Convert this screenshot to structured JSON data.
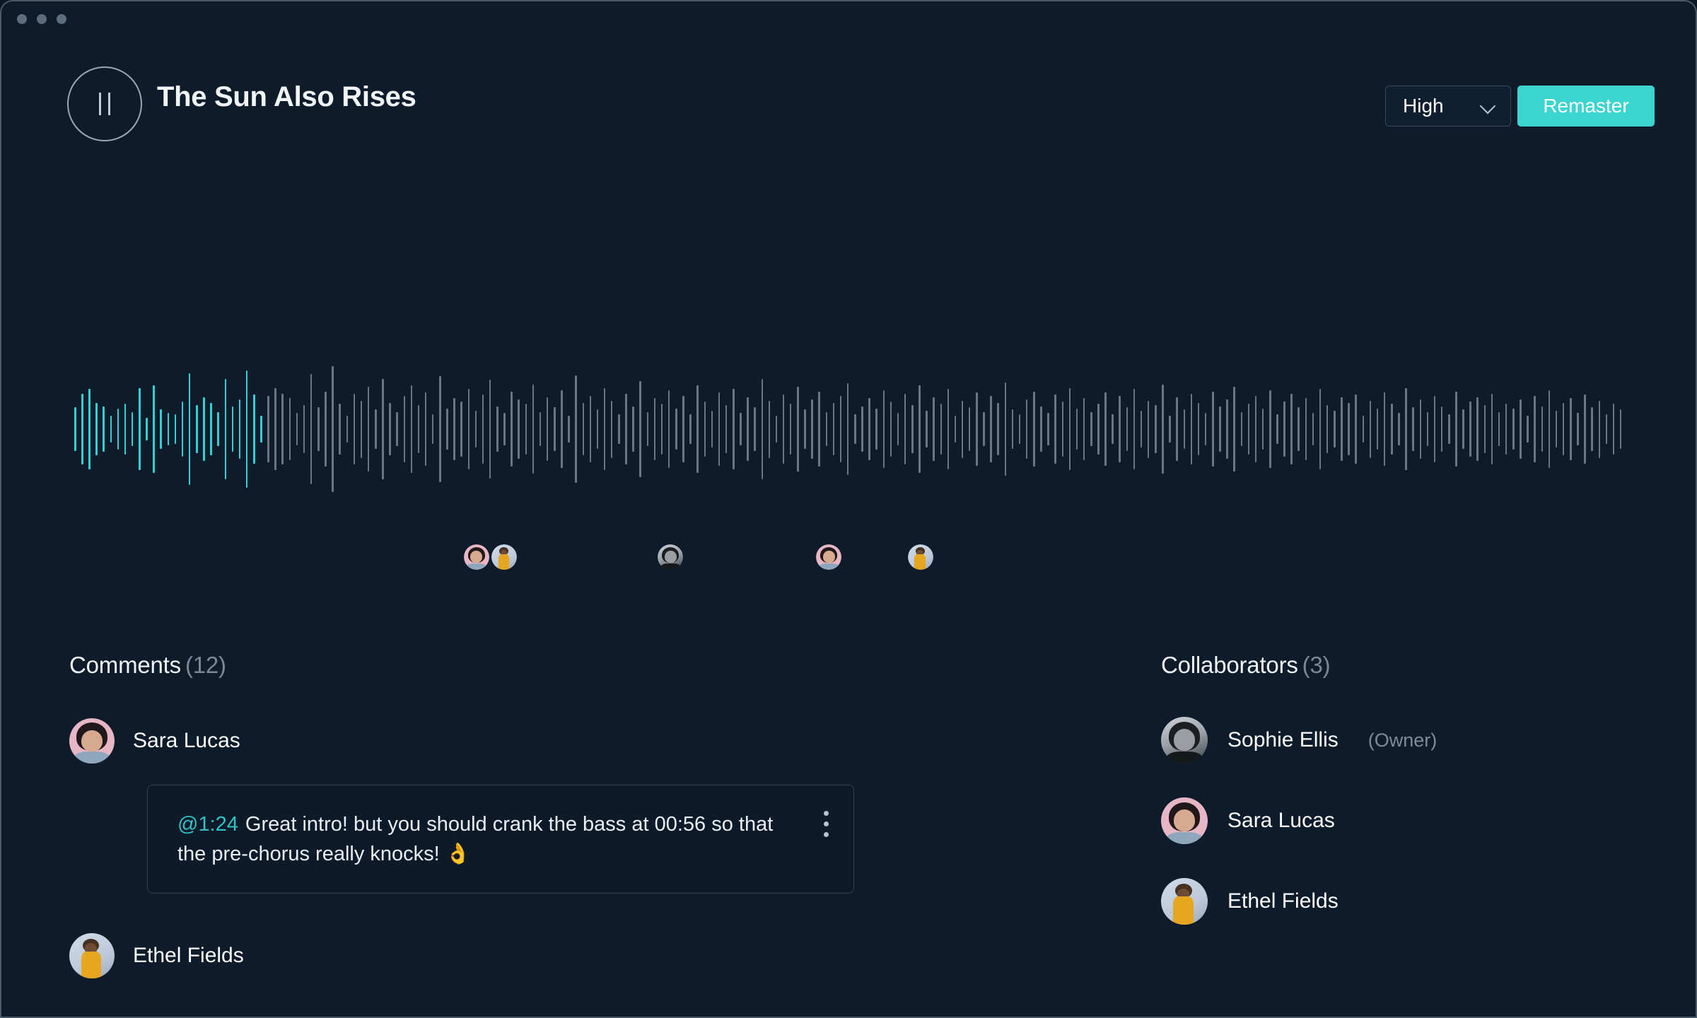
{
  "window": {
    "traffic_lights": [
      "close",
      "minimize",
      "maximize"
    ]
  },
  "header": {
    "play_icon": "pause-icon",
    "track_title": "The Sun Also Rises",
    "quality_value": "High",
    "quality_options": [
      "High"
    ],
    "chevron_icon": "chevron-down-icon",
    "remaster_label": "Remaster"
  },
  "colors": {
    "background": "#0d1b2a",
    "accent_teal": "#3ad5ce",
    "waveform_played": "#2ed3d3",
    "waveform_unplayed": "#8d9aa7",
    "timestamp_teal": "#2fc4c4",
    "muted_text": "#7b8794"
  },
  "waveform": {
    "played_fraction": 0.124,
    "bar_count": 220,
    "heights": [
      38,
      62,
      70,
      46,
      40,
      24,
      36,
      44,
      30,
      72,
      20,
      76,
      34,
      28,
      26,
      48,
      98,
      42,
      56,
      46,
      30,
      88,
      40,
      52,
      102,
      60,
      24,
      58,
      72,
      62,
      54,
      28,
      42,
      96,
      38,
      66,
      110,
      44,
      24,
      62,
      50,
      74,
      34,
      88,
      46,
      30,
      58,
      76,
      42,
      64,
      26,
      92,
      36,
      54,
      48,
      70,
      32,
      60,
      86,
      40,
      28,
      66,
      52,
      44,
      78,
      30,
      56,
      38,
      68,
      24,
      94,
      46,
      58,
      34,
      72,
      50,
      26,
      62,
      40,
      84,
      30,
      54,
      44,
      68,
      36,
      58,
      26,
      76,
      48,
      32,
      64,
      42,
      70,
      28,
      56,
      38,
      88,
      50,
      24,
      60,
      44,
      74,
      34,
      52,
      66,
      30,
      46,
      58,
      80,
      26,
      40,
      54,
      36,
      68,
      48,
      28,
      62,
      42,
      76,
      32,
      56,
      44,
      70,
      24,
      50,
      38,
      64,
      30,
      58,
      46,
      82,
      34,
      26,
      52,
      66,
      40,
      28,
      60,
      48,
      72,
      36,
      54,
      30,
      44,
      64,
      26,
      58,
      38,
      70,
      32,
      50,
      42,
      78,
      24,
      56,
      34,
      62,
      46,
      28,
      66,
      40,
      52,
      74,
      30,
      44,
      58,
      36,
      68,
      26,
      48,
      62,
      38,
      54,
      28,
      70,
      42,
      32,
      56,
      46,
      60,
      24,
      50,
      36,
      64,
      44,
      28,
      72,
      38,
      52,
      30,
      58,
      40,
      26,
      66,
      34,
      48,
      56,
      42,
      62,
      30,
      44,
      36,
      52,
      24,
      58,
      40,
      68,
      32,
      46,
      54,
      28,
      60,
      38,
      50,
      26,
      44,
      34
    ]
  },
  "markers": [
    {
      "user": "Sara Lucas",
      "x_pct": 0.259,
      "avatar": "av-sara"
    },
    {
      "user": "Ethel Fields",
      "x_pct": 0.277,
      "avatar": "av-ethel"
    },
    {
      "user": "Sophie Ellis",
      "x_pct": 0.384,
      "avatar": "av-sophie"
    },
    {
      "user": "Sara Lucas",
      "x_pct": 0.486,
      "avatar": "av-sara"
    },
    {
      "user": "Ethel Fields",
      "x_pct": 0.545,
      "avatar": "av-ethel"
    }
  ],
  "comments": {
    "title": "Comments",
    "count": "(12)",
    "items": [
      {
        "author": "Sara Lucas",
        "avatar": "av-sara",
        "timestamp": "@1:24",
        "text": "Great intro! but you should crank the bass at 00:56 so that the pre-chorus really knocks! 👌",
        "menu_icon": "kebab-menu-icon"
      },
      {
        "author": "Ethel Fields",
        "avatar": "av-ethel",
        "timestamp": "",
        "text": ""
      }
    ]
  },
  "collaborators": {
    "title": "Collaborators",
    "count": "(3)",
    "items": [
      {
        "name": "Sophie Ellis",
        "role": "(Owner)",
        "avatar": "av-sophie"
      },
      {
        "name": "Sara Lucas",
        "role": "",
        "avatar": "av-sara"
      },
      {
        "name": "Ethel Fields",
        "role": "",
        "avatar": "av-ethel"
      }
    ]
  }
}
